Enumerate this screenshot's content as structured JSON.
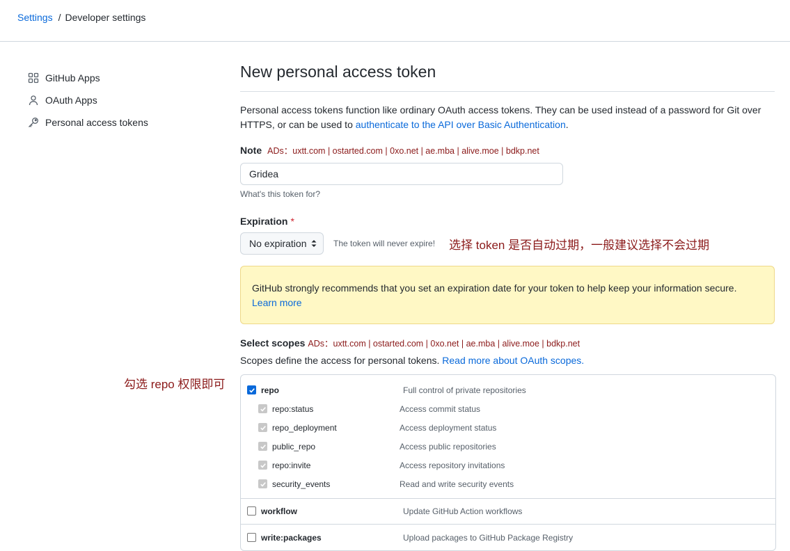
{
  "breadcrumb": {
    "root": "Settings",
    "sep": "/",
    "current": "Developer settings"
  },
  "sidebar": {
    "items": [
      {
        "label": "GitHub Apps",
        "icon": "apps-grid-icon"
      },
      {
        "label": "OAuth Apps",
        "icon": "person-icon"
      },
      {
        "label": "Personal access tokens",
        "icon": "key-icon"
      }
    ]
  },
  "page": {
    "title": "New personal access token",
    "desc_text": "Personal access tokens function like ordinary OAuth access tokens. They can be used instead of a password for Git over HTTPS, or can be used to ",
    "desc_link": "authenticate to the API over Basic Authentication",
    "desc_end": "."
  },
  "note": {
    "label": "Note",
    "ads": "ADs：uxtt.com | ostarted.com | 0xo.net | ae.mba | alive.moe | bdkp.net",
    "value": "Gridea",
    "hint": "What's this token for?"
  },
  "expiration": {
    "label": "Expiration",
    "required_mark": "*",
    "selected": "No expiration",
    "note": "The token will never expire!",
    "annotation": "选择 token 是否自动过期，一般建议选择不会过期"
  },
  "flash": {
    "text": "GitHub strongly recommends that you set an expiration date for your token to help keep your information secure.",
    "link": "Learn more"
  },
  "scopes": {
    "label": "Select scopes",
    "ads": "ADs：uxtt.com | ostarted.com | 0xo.net | ae.mba | alive.moe | bdkp.net",
    "desc_text": "Scopes define the access for personal tokens. ",
    "desc_link": "Read more about OAuth scopes.",
    "annotation": "勾选 repo 权限即可",
    "groups": [
      {
        "name": "repo",
        "desc": "Full control of private repositories",
        "checked": true,
        "children": [
          {
            "name": "repo:status",
            "desc": "Access commit status"
          },
          {
            "name": "repo_deployment",
            "desc": "Access deployment status"
          },
          {
            "name": "public_repo",
            "desc": "Access public repositories"
          },
          {
            "name": "repo:invite",
            "desc": "Access repository invitations"
          },
          {
            "name": "security_events",
            "desc": "Read and write security events"
          }
        ]
      },
      {
        "name": "workflow",
        "desc": "Update GitHub Action workflows",
        "checked": false
      },
      {
        "name": "write:packages",
        "desc": "Upload packages to GitHub Package Registry",
        "checked": false
      }
    ]
  },
  "colors": {
    "link": "#0969da",
    "annotation": "#8b1a1a",
    "flash_bg": "#fff8c5",
    "checkbox_checked": "#0969da"
  }
}
